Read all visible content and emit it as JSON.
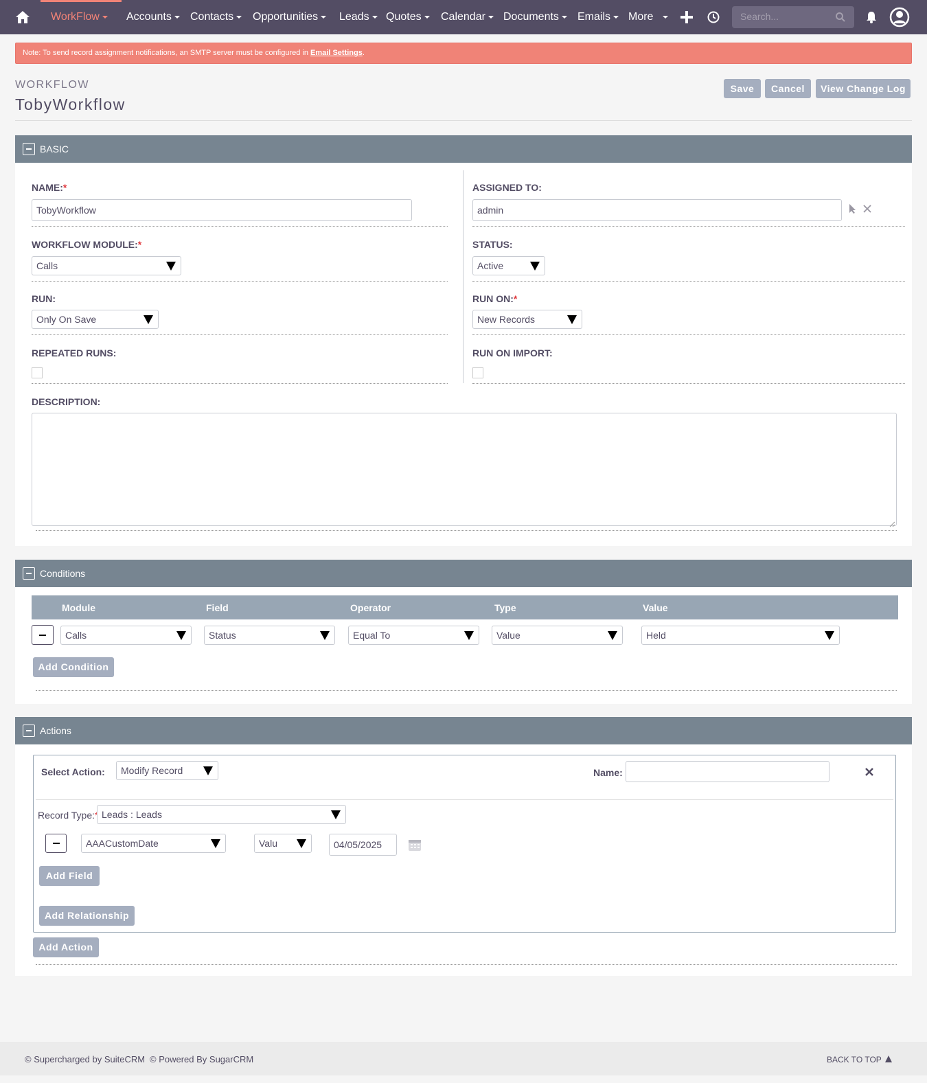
{
  "nav": {
    "items": [
      "WorkFlow",
      "Accounts",
      "Contacts",
      "Opportunities",
      "Leads",
      "Quotes",
      "Calendar",
      "Documents",
      "Emails",
      "More"
    ],
    "active": "WorkFlow",
    "search_placeholder": "Search...",
    "icons": [
      "home-icon",
      "plus-icon",
      "history-icon",
      "search-icon",
      "bell-icon",
      "user-icon"
    ]
  },
  "alert": {
    "prefix": "Note: To send record assignment notifications, an SMTP server must be configured in",
    "link": "Email Settings",
    "suffix": "."
  },
  "header": {
    "module": "WORKFLOW",
    "title": "TobyWorkflow",
    "buttons": {
      "save": "Save",
      "cancel": "Cancel",
      "changelog": "View Change Log"
    }
  },
  "basic": {
    "panel_title": "BASIC",
    "name_label": "NAME:",
    "name_value": "TobyWorkflow",
    "assigned_label": "ASSIGNED TO:",
    "assigned_value": "admin",
    "module_label": "WORKFLOW MODULE:",
    "module_value": "Calls",
    "status_label": "STATUS:",
    "status_value": "Active",
    "run_label": "RUN:",
    "run_value": "Only On Save",
    "run_on_label": "RUN ON:",
    "run_on_value": "New Records",
    "repeated_label": "REPEATED RUNS:",
    "repeated_checked": false,
    "import_label": "RUN ON IMPORT:",
    "import_checked": false,
    "description_label": "DESCRIPTION:",
    "description_value": ""
  },
  "conditions": {
    "panel_title": "Conditions",
    "headers": [
      "Module",
      "Field",
      "Operator",
      "Type",
      "Value"
    ],
    "row": {
      "module": "Calls",
      "field": "Status",
      "operator": "Equal To",
      "type": "Value",
      "value": "Held"
    },
    "add_label": "Add Condition"
  },
  "actions": {
    "panel_title": "Actions",
    "select_action_label": "Select Action:",
    "select_action_value": "Modify Record",
    "name_label": "Name:",
    "name_value": "",
    "record_type_label": "Record Type:",
    "record_type_value": "Leads : Leads",
    "field_name": "AAACustomDate",
    "field_type": "Valu",
    "field_value": "04/05/2025",
    "add_field_label": "Add Field",
    "add_relationship_label": "Add Relationship",
    "add_action_label": "Add Action"
  },
  "footer": {
    "suitecrm": "© Supercharged by SuiteCRM",
    "sugarcrm": "© Powered By SugarCRM",
    "back_to_top": "BACK TO TOP"
  }
}
